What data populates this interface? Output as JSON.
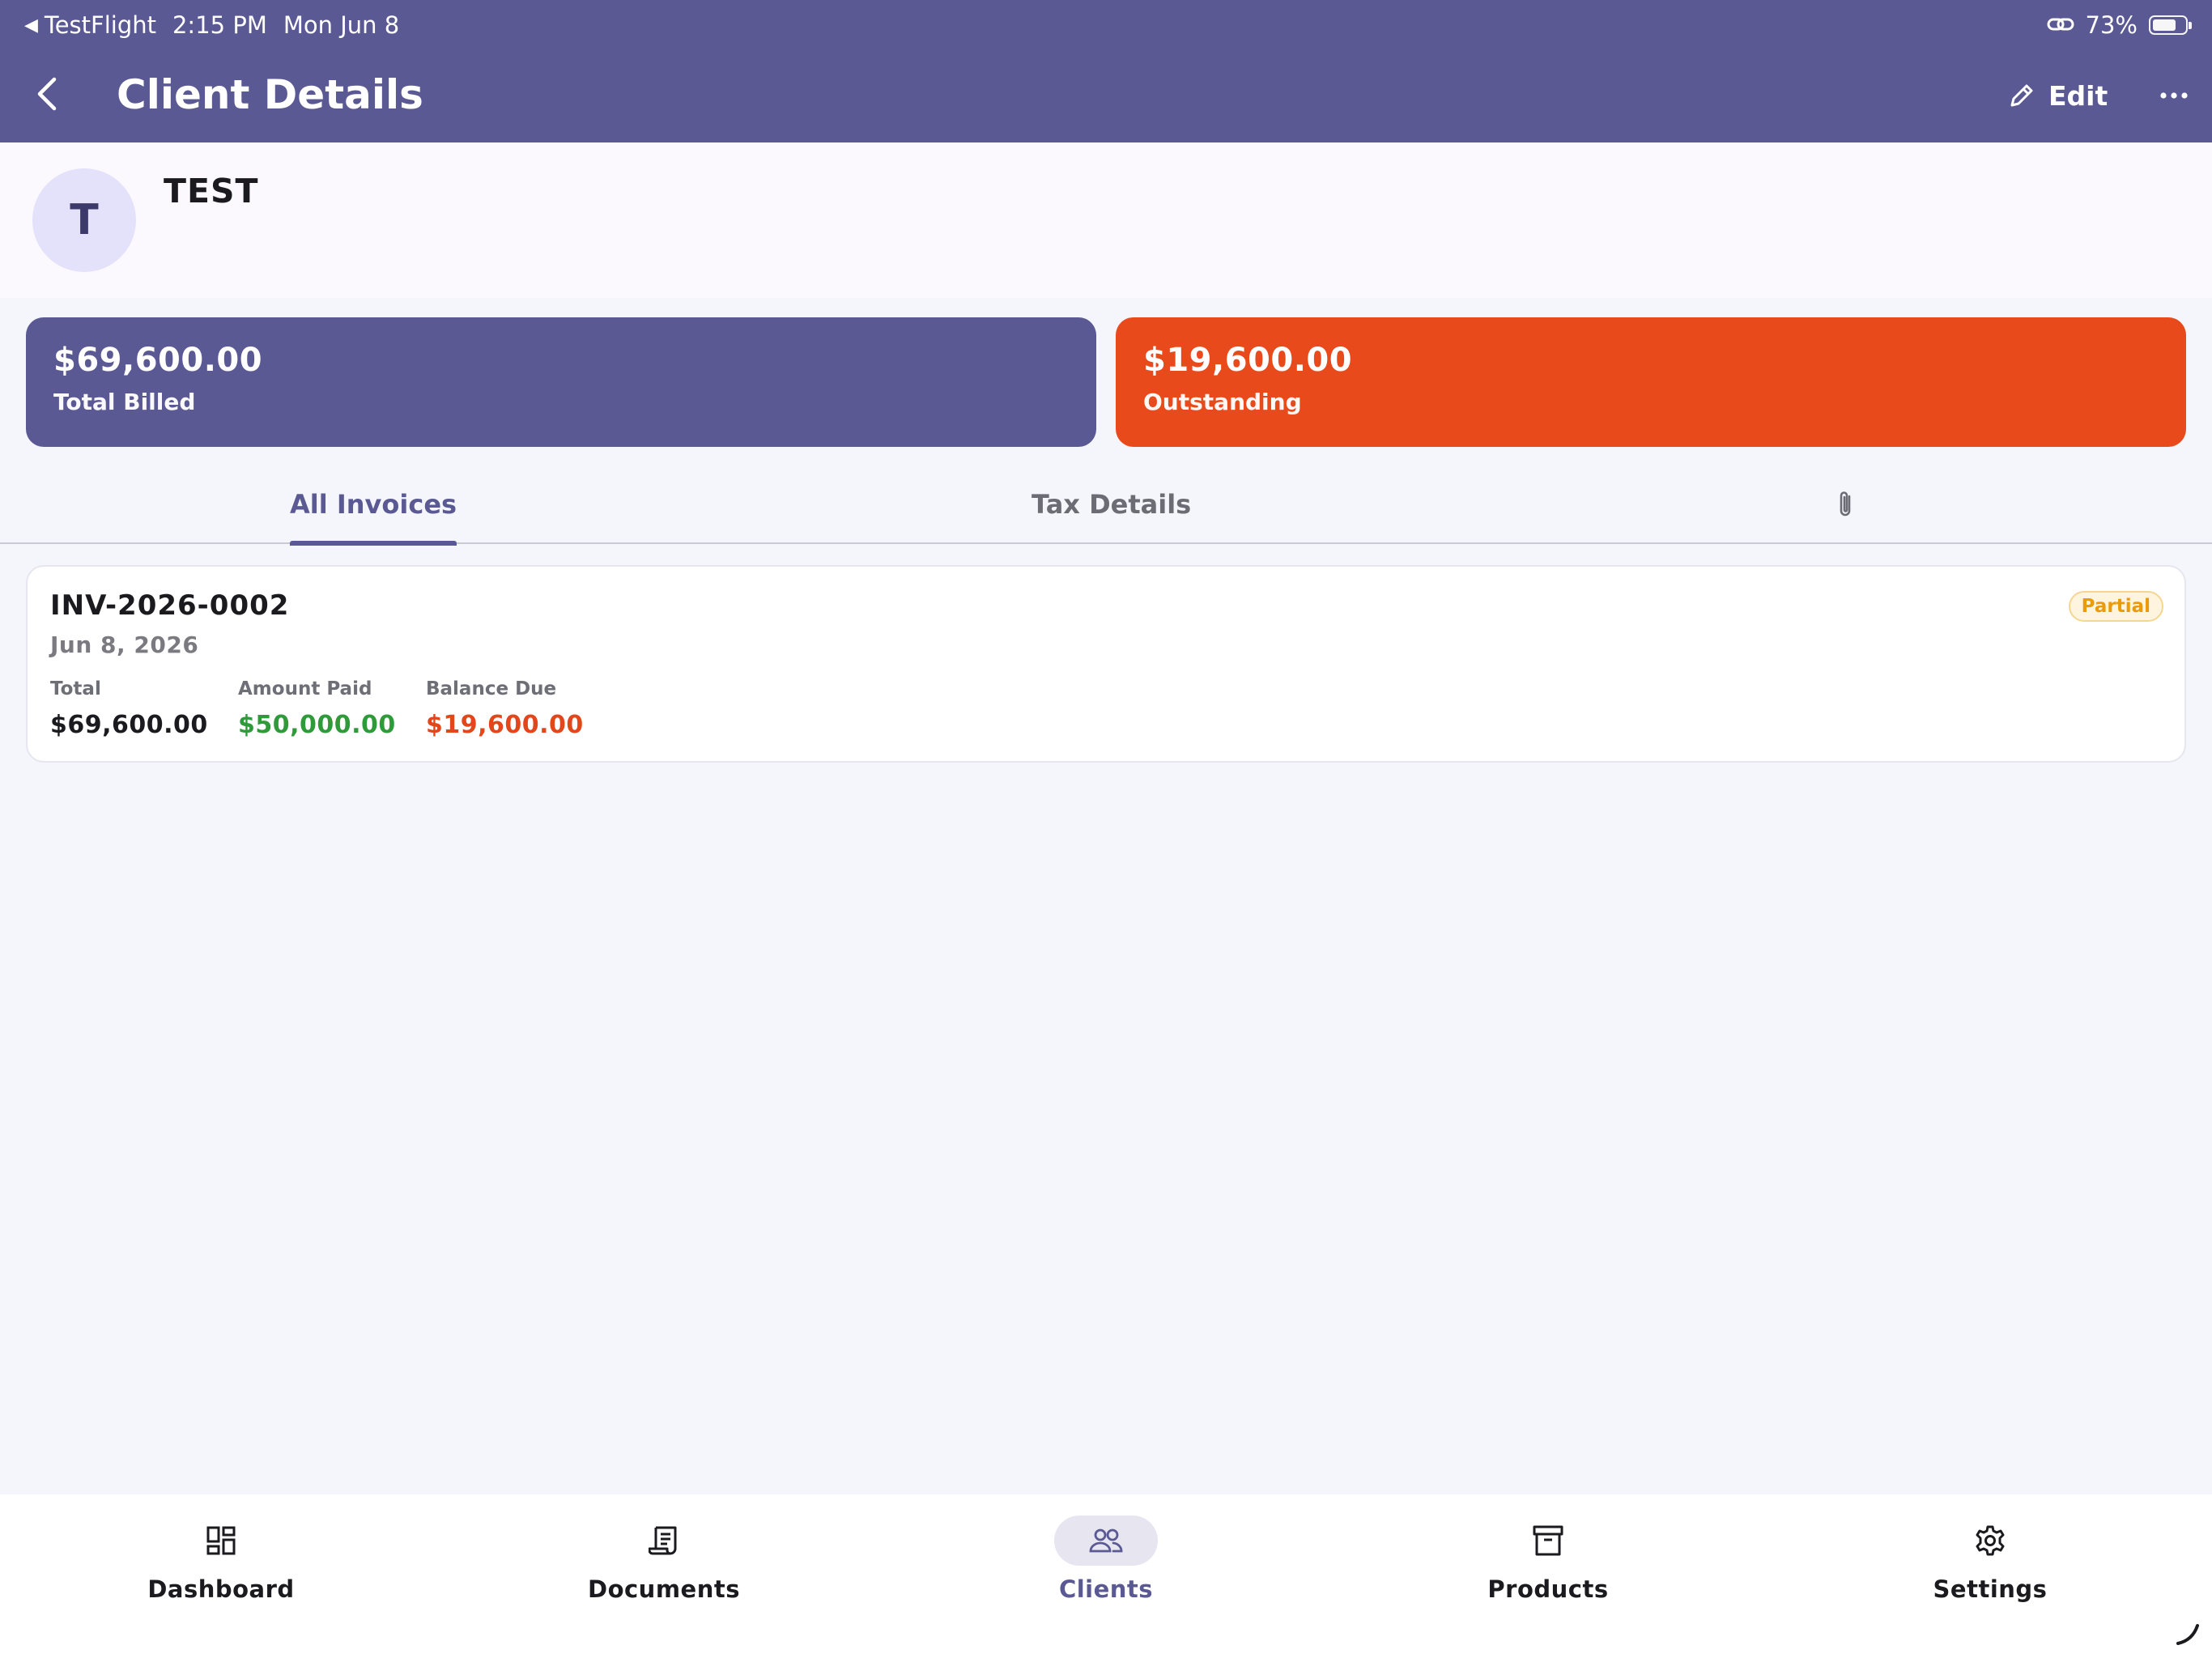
{
  "status_bar": {
    "back_app": "TestFlight",
    "time": "2:15 PM",
    "date": "Mon Jun 8",
    "battery": "73%",
    "battery_level": 0.73
  },
  "header": {
    "title": "Client Details",
    "edit_label": "Edit"
  },
  "client": {
    "initial": "T",
    "name": "TEST"
  },
  "summary": {
    "total_billed_amount": "$69,600.00",
    "total_billed_label": "Total Billed",
    "outstanding_amount": "$19,600.00",
    "outstanding_label": "Outstanding"
  },
  "tabs": [
    {
      "label": "All Invoices",
      "active": true
    },
    {
      "label": "Tax Details",
      "active": false
    }
  ],
  "invoice": {
    "number": "INV-2026-0002",
    "date": "Jun 8, 2026",
    "status": "Partial",
    "total_label": "Total",
    "total_value": "$69,600.00",
    "paid_label": "Amount Paid",
    "paid_value": "$50,000.00",
    "balance_label": "Balance Due",
    "balance_value": "$19,600.00"
  },
  "bottom_nav": [
    {
      "label": "Dashboard",
      "icon": "dashboard-icon"
    },
    {
      "label": "Documents",
      "icon": "documents-icon"
    },
    {
      "label": "Clients",
      "icon": "clients-icon",
      "active": true
    },
    {
      "label": "Products",
      "icon": "products-icon"
    },
    {
      "label": "Settings",
      "icon": "settings-icon"
    }
  ],
  "colors": {
    "primary": "#5b5993",
    "outstanding": "#e84a1b",
    "paid": "#2f9a3a",
    "partial_badge": "#eb9a09"
  }
}
